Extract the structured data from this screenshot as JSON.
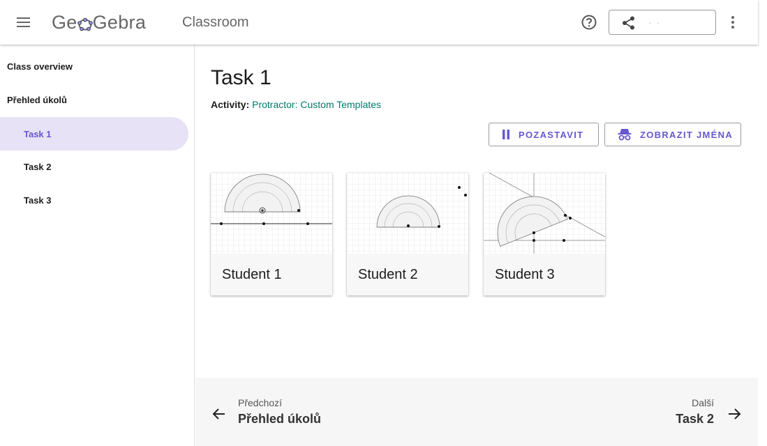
{
  "header": {
    "logo_part1": "Ge",
    "logo_part2": "Gebra",
    "app_title": "Classroom",
    "share_label": "·         ·",
    "icons": {
      "menu": "hamburger-menu-icon",
      "help": "help-circle-icon",
      "share": "share-icon",
      "more": "more-vert-icon"
    }
  },
  "sidebar": {
    "items": [
      {
        "label": "Class overview",
        "level": "top",
        "active": false
      },
      {
        "label": "Přehled úkolů",
        "level": "top",
        "active": false
      },
      {
        "label": "Task 1",
        "level": "sub",
        "active": true
      },
      {
        "label": "Task 2",
        "level": "sub",
        "active": false
      },
      {
        "label": "Task 3",
        "level": "sub",
        "active": false
      }
    ]
  },
  "main": {
    "title": "Task 1",
    "activity_label": "Activity:",
    "activity_name": "Protractor: Custom Templates",
    "pause_label": "POZASTAVIT",
    "names_label": "ZOBRAZIT JMÉNA",
    "students": [
      {
        "name": "Student 1"
      },
      {
        "name": "Student 2"
      },
      {
        "name": "Student 3"
      }
    ]
  },
  "footer": {
    "prev_small": "Předchozí",
    "prev_big": "Přehled úkolů",
    "next_small": "Další",
    "next_big": "Task 2"
  },
  "colors": {
    "accent": "#6557d2",
    "active_bg": "#e7e2f6",
    "link": "#00796b",
    "footer_bg": "#f6f6f6"
  }
}
